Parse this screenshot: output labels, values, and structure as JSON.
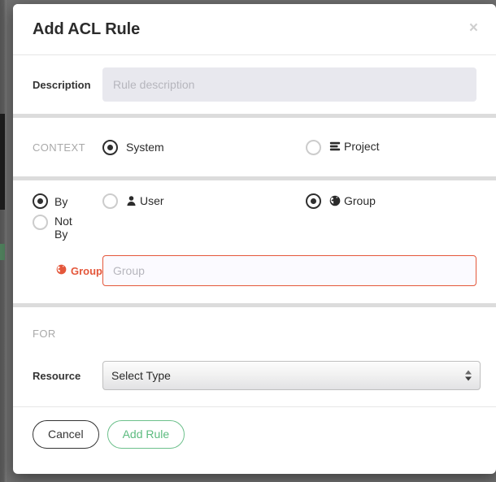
{
  "modal": {
    "title": "Add ACL Rule",
    "close_label": "×",
    "close_icon": "close-icon"
  },
  "description": {
    "label": "Description",
    "placeholder": "Rule description",
    "value": ""
  },
  "context": {
    "label": "CONTEXT",
    "options": [
      {
        "label": "System",
        "selected": true,
        "icon": ""
      },
      {
        "label": "Project",
        "selected": false,
        "icon": "server-stack-icon"
      }
    ]
  },
  "subject": {
    "mode_options": [
      {
        "label": "By",
        "selected": true
      },
      {
        "label": "Not By",
        "selected": false
      }
    ],
    "type_options": [
      {
        "label": "User",
        "selected": false,
        "icon": "user-icon"
      },
      {
        "label": "Group",
        "selected": true,
        "icon": "globe-icon"
      }
    ],
    "field": {
      "label": "Group",
      "icon": "globe-icon",
      "placeholder": "Group",
      "value": "",
      "error": true
    }
  },
  "for_section": {
    "label": "FOR",
    "resource": {
      "label": "Resource",
      "selected": "Select Type",
      "options": [
        "Select Type"
      ]
    }
  },
  "footer": {
    "cancel_label": "Cancel",
    "submit_label": "Add Rule"
  },
  "colors": {
    "error": "#e4573b",
    "primary": "#5cbb7f",
    "muted": "#a9a9a9",
    "divider": "#dcdcdc"
  }
}
